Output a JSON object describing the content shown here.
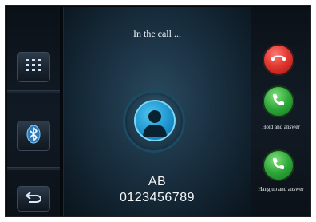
{
  "call": {
    "status": "In the call ...",
    "contact_name": "AB",
    "contact_number": "0123456789"
  },
  "left_sidebar": {
    "items": [
      {
        "icon": "keypad-icon"
      },
      {
        "icon": "bluetooth-icon"
      },
      {
        "icon": "back-arrow-icon"
      }
    ]
  },
  "right_actions": {
    "hang_up": {
      "icon": "hang-up-icon",
      "color": "#e23a33"
    },
    "hold_and_answer": {
      "label": "Hold and answer",
      "icon": "phone-answer-icon",
      "color": "#2fa73a"
    },
    "hang_up_and_answer": {
      "label": "Hang up and answer",
      "icon": "phone-answer-icon",
      "color": "#2fa73a"
    }
  }
}
